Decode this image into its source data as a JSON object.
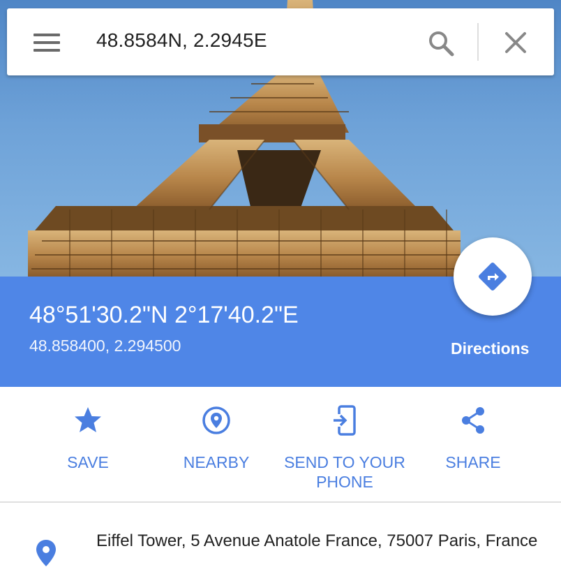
{
  "search": {
    "query": "48.8584N, 2.2945E"
  },
  "place": {
    "coordinates_dms": "48°51'30.2\"N 2°17'40.2\"E",
    "coordinates_decimal": "48.858400, 2.294500",
    "directions_label": "Directions"
  },
  "actions": [
    {
      "label": "SAVE",
      "icon": "star-icon"
    },
    {
      "label": "NEARBY",
      "icon": "nearby-icon"
    },
    {
      "label": "SEND TO YOUR PHONE",
      "icon": "send-to-phone-icon"
    },
    {
      "label": "SHARE",
      "icon": "share-icon"
    }
  ],
  "address": {
    "text": "Eiffel Tower, 5 Avenue Anatole France, 75007 Paris, France"
  },
  "colors": {
    "accent": "#4f86e7",
    "action_blue": "#4a7ee0",
    "sky": "#6ea2d8",
    "tower": "#b5874a"
  }
}
